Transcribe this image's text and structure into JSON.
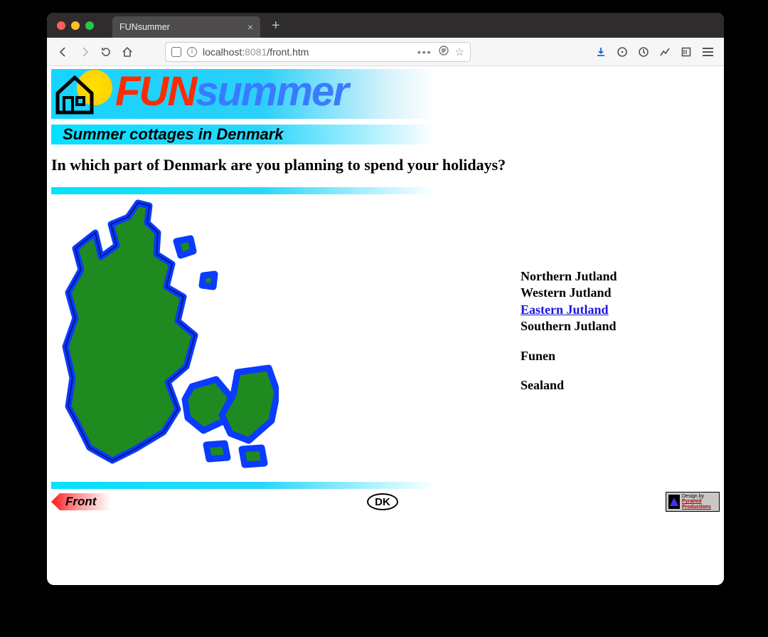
{
  "browser": {
    "tab_title": "FUNsummer",
    "url_host": "localhost:",
    "url_port": "8081",
    "url_path": "/front.htm"
  },
  "logo": {
    "fun": "FUN",
    "summer": "summer"
  },
  "subtitle": "Summer cottages in Denmark",
  "question": "In which part of Denmark are you planning to spend your holidays?",
  "regions": {
    "r1": "Northern Jutland",
    "r2": "Western Jutland",
    "r3": "Eastern Jutland",
    "r4": "Southern Jutland",
    "r5": "Funen",
    "r6": "Sealand"
  },
  "footer": {
    "front": "Front",
    "dk": "DK",
    "credit_line1": "Design by",
    "credit_line2": "Pyramid",
    "credit_line3": "Productions"
  }
}
